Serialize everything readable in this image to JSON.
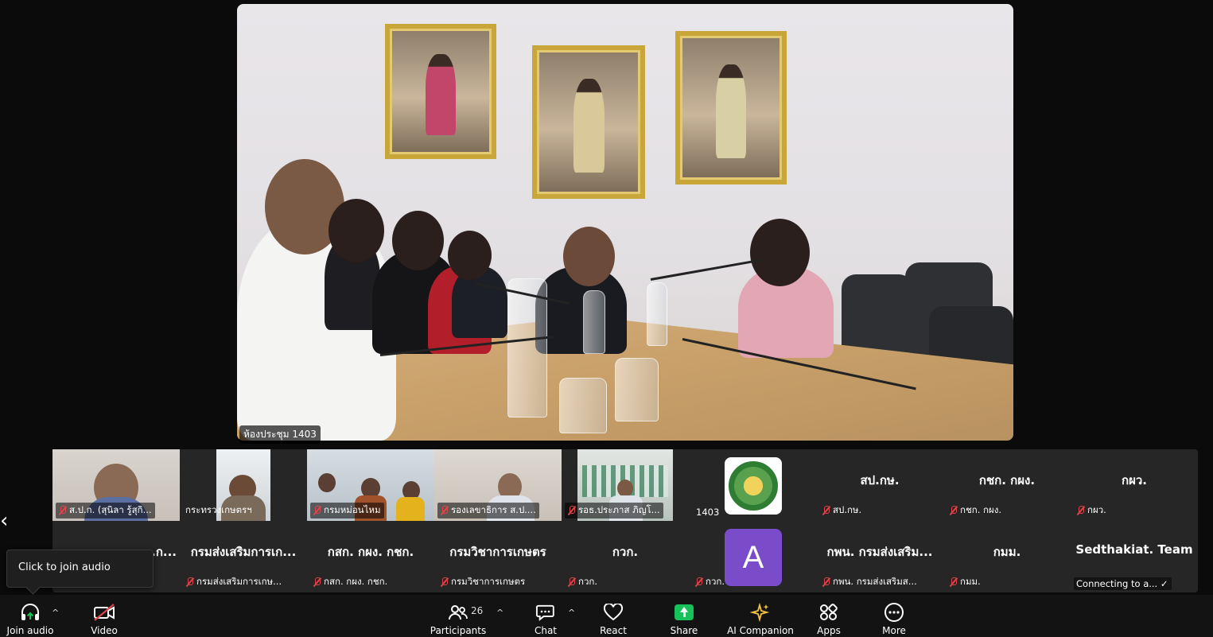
{
  "main_video": {
    "label": "ห้องประชุม 1403"
  },
  "gallery": {
    "row1": [
      {
        "name": "ส.ป.ก. (สุนิลา รู้สุกิ...",
        "muted": true
      },
      {
        "name": "กระทรวงเกษตรฯ",
        "muted": false
      },
      {
        "name": "กรมหม่อนไหม",
        "muted": true
      },
      {
        "name": "รองเลขาธิการ ส.ป....",
        "muted": true
      },
      {
        "name": "รอธ.ประภาส ภิญโ...",
        "muted": true
      },
      {
        "name": "1403",
        "muted": false
      },
      {
        "name": "สป.กษ.",
        "muted": true,
        "big": "สป.กษ."
      },
      {
        "name": "กชก. กผง.",
        "muted": true,
        "big": "กชก. กผง."
      },
      {
        "name": "กผว.",
        "muted": true,
        "big": "กผว."
      }
    ],
    "row2": [
      {
        "big": "...ก...",
        "name": "",
        "muted": false
      },
      {
        "big": "กรมส่งเสริมการเก...",
        "name": "กรมส่งเสริมการเกษ...",
        "muted": true
      },
      {
        "big": "กสก. กผง. กชก.",
        "name": "กสก. กผง. กชก.",
        "muted": true
      },
      {
        "big": "กรมวิชาการเกษตร",
        "name": "กรมวิชาการเกษตร",
        "muted": true
      },
      {
        "big": "กวก.",
        "name": "กวก.",
        "muted": true
      },
      {
        "big": "",
        "name": "กวก.",
        "muted": true,
        "avatar": "A"
      },
      {
        "big": "กพน. กรมส่งเสริม...",
        "name": "กพน. กรมส่งเสริมส...",
        "muted": true
      },
      {
        "big": "กมม.",
        "name": "กมม.",
        "muted": true
      },
      {
        "big": "Sedthakiat. Team",
        "name": "Connecting to a... ✓",
        "muted": false
      }
    ]
  },
  "tooltip": {
    "text": "Click to join audio"
  },
  "toolbar": {
    "join_audio": "Join audio",
    "video": "Video",
    "participants": "Participants",
    "participant_count": "26",
    "chat": "Chat",
    "react": "React",
    "share": "Share",
    "ai_companion": "AI Companion",
    "apps": "Apps",
    "more": "More"
  },
  "colors": {
    "share_green": "#18c15a",
    "muted_red": "#e0444b",
    "avatar_purple": "#7b4cc9"
  }
}
